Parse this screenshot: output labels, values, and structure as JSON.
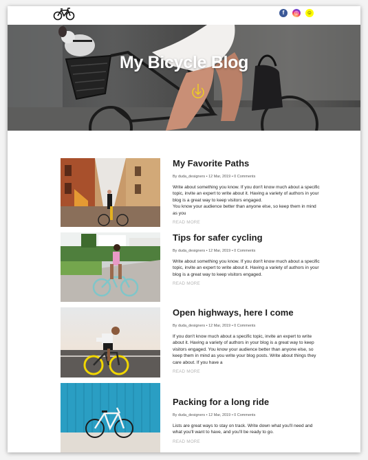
{
  "header": {
    "logo_icon": "bicycle-icon",
    "socials": [
      {
        "name": "facebook-icon",
        "glyph": "f",
        "color": "#3b5998"
      },
      {
        "name": "instagram-icon",
        "glyph": "◎",
        "color": "#d6249f"
      },
      {
        "name": "snapchat-icon",
        "glyph": "☺",
        "color": "#fffc00"
      }
    ]
  },
  "hero": {
    "title": "My Bicycle Blog",
    "scroll_icon": "arrow-down-circle-icon",
    "accent_color": "#f2d21b"
  },
  "posts": [
    {
      "title": "My Favorite Paths",
      "meta": "By duda_designers • 12 Mar, 2019 • 0 Comments",
      "excerpt": [
        "Write about something you know. If you don't know much about a specific topic, invite an expert to write about it. Having a variety of authors in your blog is a great way to keep visitors engaged.",
        "You know your audience better than anyone else, so keep them in mind as you"
      ],
      "read_more": "READ MORE"
    },
    {
      "title": "Tips for safer cycling",
      "meta": "By duda_designers • 12 Mar, 2019 • 0 Comments",
      "excerpt": [
        "Write about something you know. If you don't know much about a specific topic, invite an expert to write about it. Having a variety of authors in your blog is a great way to keep visitors engaged."
      ],
      "read_more": "READ MORE"
    },
    {
      "title": "Open highways, here I come",
      "meta": "By duda_designers • 12 Mar, 2019 • 0 Comments",
      "excerpt": [
        "If you don't know much about a specific topic, invite an expert to write about it. Having a variety of authors in your blog is a great way to keep visitors engaged. You know your audience better than anyone else, so keep them in mind as you write your blog posts. Write about things they care about. If you have a"
      ],
      "read_more": "READ MORE"
    },
    {
      "title": "Packing for a long ride",
      "meta": "By duda_designers • 12 Mar, 2019 • 0 Comments",
      "excerpt": [
        "Lists are great ways to stay on track. Write down what you'll need and what you'll want to have, and you'll be ready to go."
      ],
      "read_more": "READ MORE"
    }
  ]
}
